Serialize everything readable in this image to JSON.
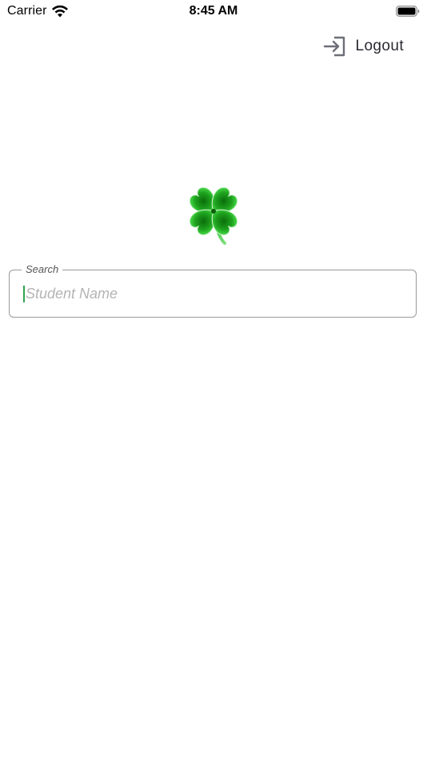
{
  "status_bar": {
    "carrier": "Carrier",
    "time": "8:45 AM"
  },
  "header": {
    "logout_label": "Logout",
    "logout_icon": "logout-icon"
  },
  "logo": {
    "icon": "four-leaf-clover",
    "color": "#1e9b1e"
  },
  "search": {
    "label": "Search",
    "placeholder": "Student Name",
    "value": "",
    "caret_color": "#2ea44f"
  }
}
